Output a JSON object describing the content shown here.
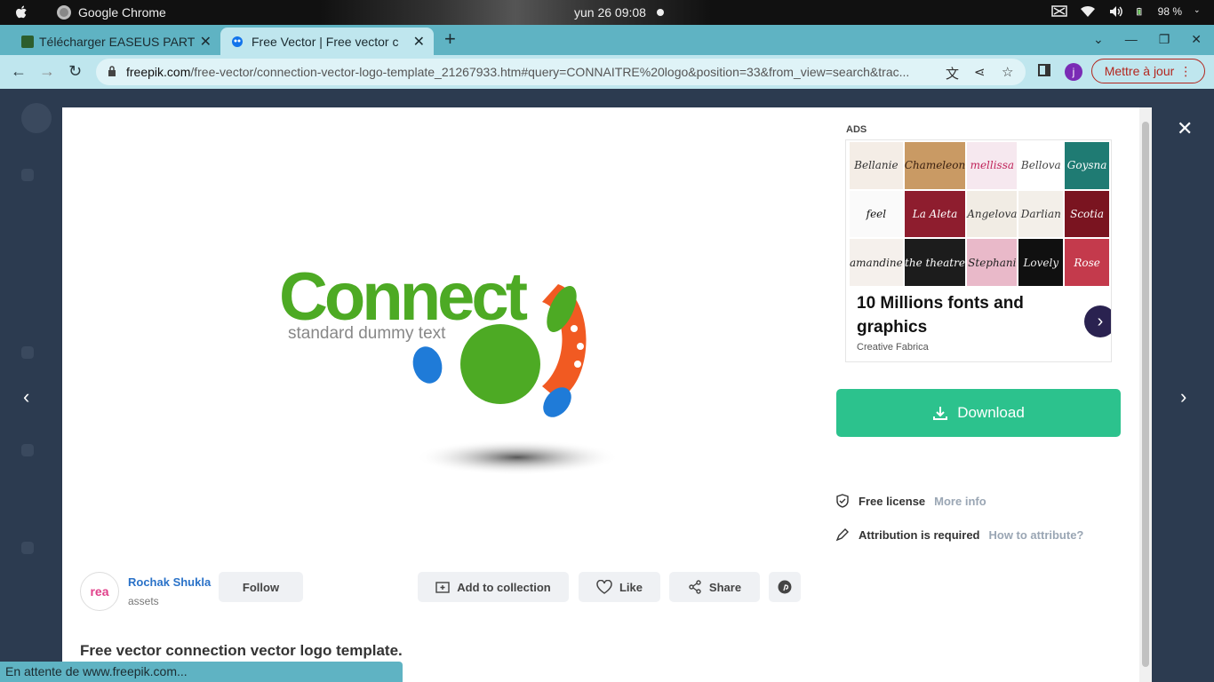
{
  "topbar": {
    "app_name": "Google Chrome",
    "clock": "yun 26  09:08",
    "battery": "98 %"
  },
  "tabs": [
    {
      "title": "Télécharger EASEUS PART"
    },
    {
      "title": "Free Vector | Free vector c"
    }
  ],
  "address": {
    "host": "freepik.com",
    "path": "/free-vector/connection-vector-logo-template_21267933.htm#query=CONNAITRE%20logo&position=33&from_view=search&trac..."
  },
  "profile_initial": "j",
  "update_label": "Mettre à jour",
  "logo": {
    "word": "Connect",
    "tagline": "standard dummy text"
  },
  "ad": {
    "label": "ADS",
    "thumbs": [
      "Bellanie",
      "Chameleon",
      "mellissa",
      "Bellova",
      "Goysna",
      "feel",
      "La Aleta",
      "Angelova",
      "Darlian",
      "Scotia",
      "amandine",
      "the theatre",
      "Stephani",
      "Lovely",
      "Rose"
    ],
    "title": "10 Millions fonts and graphics",
    "sponsor": "Creative Fabrica"
  },
  "download_label": "Download",
  "license": {
    "label": "Free license",
    "link": "More info"
  },
  "attribution": {
    "label": "Attribution is required",
    "link": "How to attribute?"
  },
  "author": {
    "avatar_text": "rea",
    "name": "Rochak Shukla",
    "sub": "assets",
    "follow_label": "Follow"
  },
  "actions": {
    "collection": "Add to collection",
    "like": "Like",
    "share": "Share"
  },
  "description": "Free vector connection vector logo template.",
  "status": "En attente de www.freepik.com..."
}
